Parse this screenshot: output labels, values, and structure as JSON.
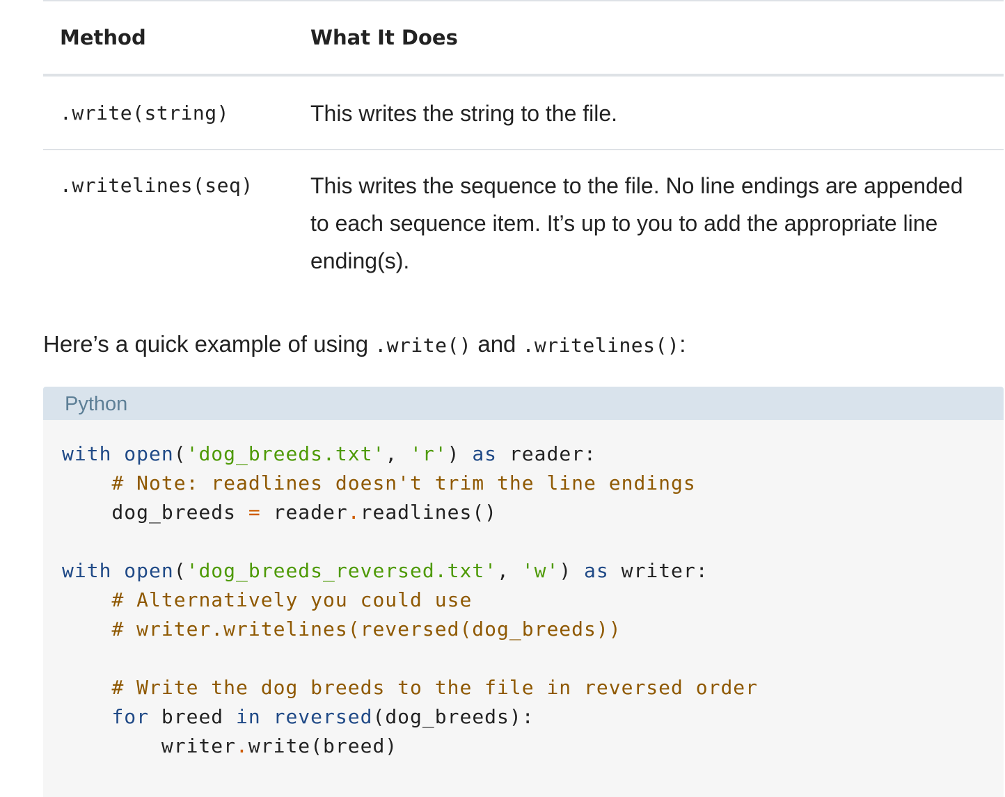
{
  "table": {
    "headers": [
      "Method",
      "What It Does"
    ],
    "rows": [
      {
        "method": ".write(string)",
        "description": "This writes the string to the file."
      },
      {
        "method": ".writelines(seq)",
        "description": "This writes the sequence to the file. No line endings are appended to each sequence item. It’s up to you to add the appropriate line ending(s)."
      }
    ]
  },
  "intro": {
    "prefix": "Here’s a quick example of using ",
    "code1": ".write()",
    "middle": " and ",
    "code2": ".writelines()",
    "suffix": ":"
  },
  "code_block": {
    "language": "Python",
    "lines": [
      "with open('dog_breeds.txt', 'r') as reader:",
      "    # Note: readlines doesn't trim the line endings",
      "    dog_breeds = reader.readlines()",
      "",
      "with open('dog_breeds_reversed.txt', 'w') as writer:",
      "    # Alternatively you could use",
      "    # writer.writelines(reversed(dog_breeds))",
      "",
      "    # Write the dog breeds to the file in reversed order",
      "    for breed in reversed(dog_breeds):",
      "        writer.write(breed)"
    ]
  },
  "colors": {
    "keyword": "#204a87",
    "string": "#4e9a06",
    "comment": "#8f5902",
    "operator": "#ce5c00",
    "code_background": "#f6f6f6",
    "code_header_background": "#d9e3ec",
    "code_header_text": "#5d7f96"
  }
}
